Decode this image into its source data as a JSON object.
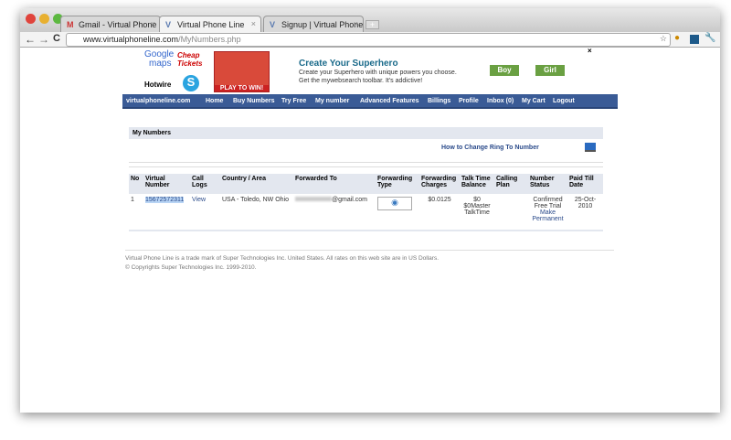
{
  "browser": {
    "tabs": [
      {
        "label": "Gmail - Virtual Phone Line -"
      },
      {
        "label": "Virtual Phone Line"
      },
      {
        "label": "Signup | Virtual Phone Line"
      }
    ],
    "url_domain": "www.virtualphoneline.com",
    "url_path": "/MyNumbers.php"
  },
  "ads": {
    "google": "Google",
    "maps": "maps",
    "cheap": "Cheap",
    "tickets": "Tickets",
    "hotwire": "Hotwire",
    "play": "PLAY TO WIN!",
    "title": "Create Your Superhero",
    "line1": "Create your Superhero with unique powers you choose.",
    "line2": "Get the mywebsearch toolbar. It's addictive!",
    "boy": "Boy",
    "girl": "Girl",
    "close": "×"
  },
  "nav": {
    "brand": "virtualphoneline.com",
    "items": [
      "Home",
      "Buy Numbers",
      "Try Free",
      "My number",
      "Advanced Features",
      "Billings",
      "Profile",
      "Inbox (0)",
      "My Cart",
      "Logout"
    ]
  },
  "section": {
    "title": "My Numbers",
    "help_link": "How to Change Ring To Number"
  },
  "table": {
    "headers": [
      "No",
      "Virtual Number",
      "Call Logs",
      "Country / Area",
      "Forwarded To",
      "Forwarding Type",
      "Forwarding Charges",
      "Talk Time Balance",
      "Calling Plan",
      "Number Status",
      "Paid Till Date"
    ],
    "rows": [
      {
        "no": "1",
        "number": "15672572311",
        "logs": "View",
        "country": "USA - Toledo, NW Ohio",
        "forwarded": "@gmail.com",
        "charges": "$0.0125",
        "balance1": "$0",
        "balance2": "$0Master TalkTime",
        "plan": "",
        "status": "Confirmed Free Trial",
        "make": "Make Permanent",
        "paid": "25-Oct-2010"
      }
    ]
  },
  "footer": {
    "line1": "Virtual Phone Line is a trade mark of Super Technologies Inc. United States. All rates on this web site are in US Dollars.",
    "line2": "© Copyrights Super Technologies Inc. 1999-2010."
  }
}
